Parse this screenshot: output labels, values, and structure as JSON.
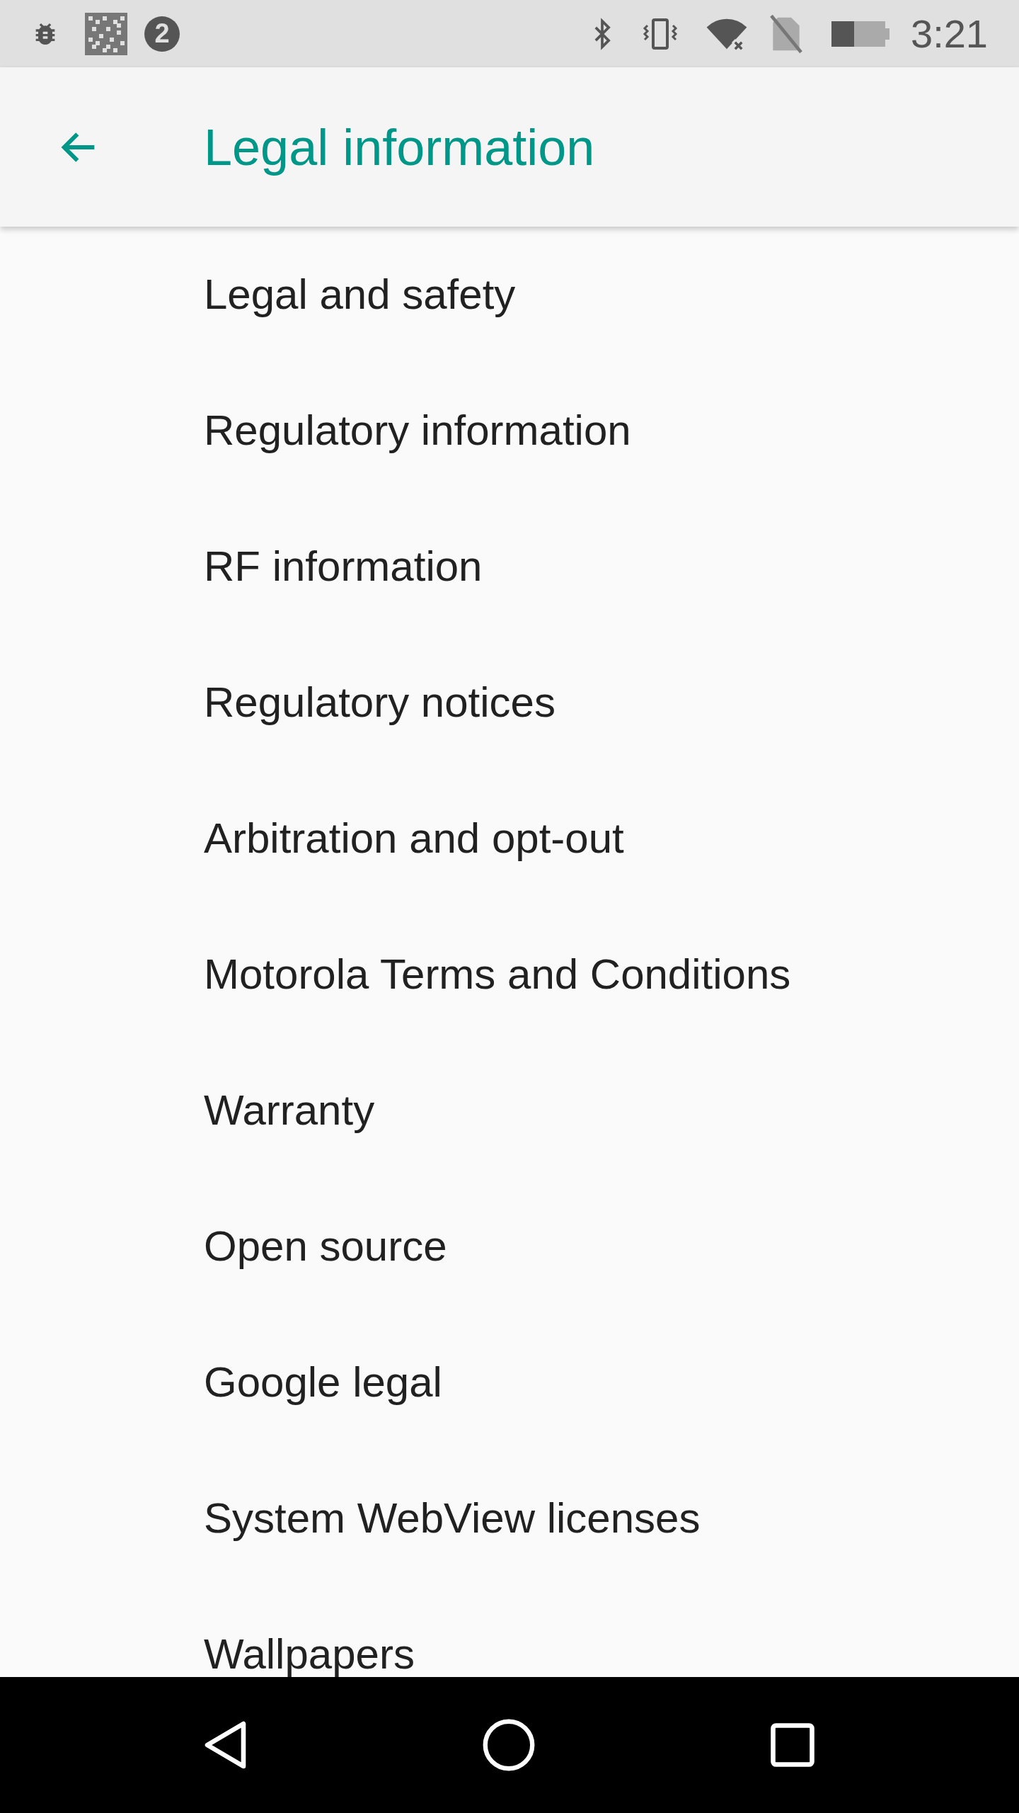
{
  "status_bar": {
    "notification_count": "2",
    "time": "3:21"
  },
  "app_bar": {
    "title": "Legal information"
  },
  "items": [
    {
      "label": "Legal and safety"
    },
    {
      "label": "Regulatory information"
    },
    {
      "label": "RF information"
    },
    {
      "label": "Regulatory notices"
    },
    {
      "label": "Arbitration and opt-out"
    },
    {
      "label": "Motorola Terms and Conditions"
    },
    {
      "label": "Warranty"
    },
    {
      "label": "Open source"
    },
    {
      "label": "Google legal"
    },
    {
      "label": "System WebView licenses"
    },
    {
      "label": "Wallpapers"
    }
  ]
}
